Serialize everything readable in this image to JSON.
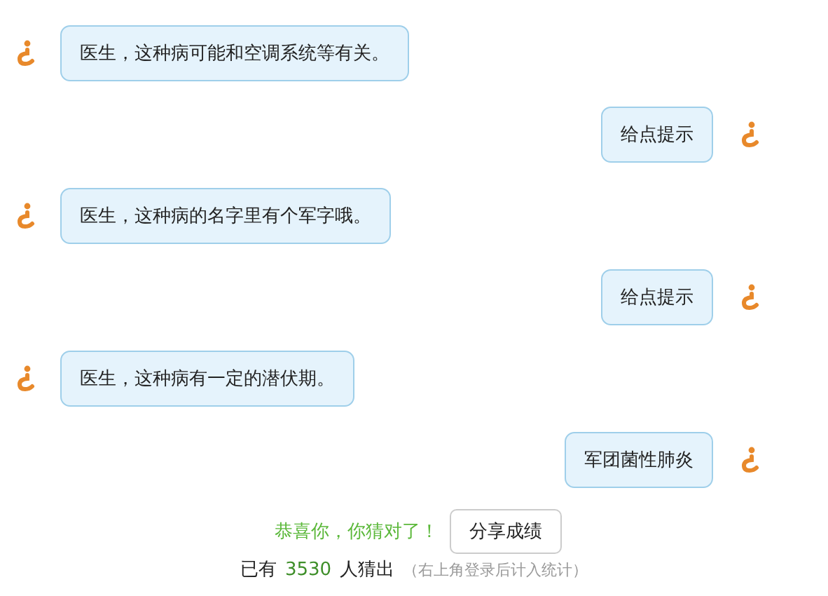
{
  "messages": [
    {
      "kind": "left",
      "text": "医生，这种病可能和空调系统等有关。"
    },
    {
      "kind": "right",
      "text": "给点提示"
    },
    {
      "kind": "left",
      "text": "医生，这种病的名字里有个军字哦。"
    },
    {
      "kind": "right",
      "text": "给点提示"
    },
    {
      "kind": "left",
      "text": "医生，这种病有一定的潜伏期。"
    },
    {
      "kind": "right",
      "text": "军团菌性肺炎"
    }
  ],
  "result": {
    "message": "恭喜你，你猜对了！",
    "share_button": "分享成绩"
  },
  "stats": {
    "prefix": "已有",
    "count": "3530",
    "suffix": "人猜出",
    "note": "（右上角登录后计入统计）"
  }
}
